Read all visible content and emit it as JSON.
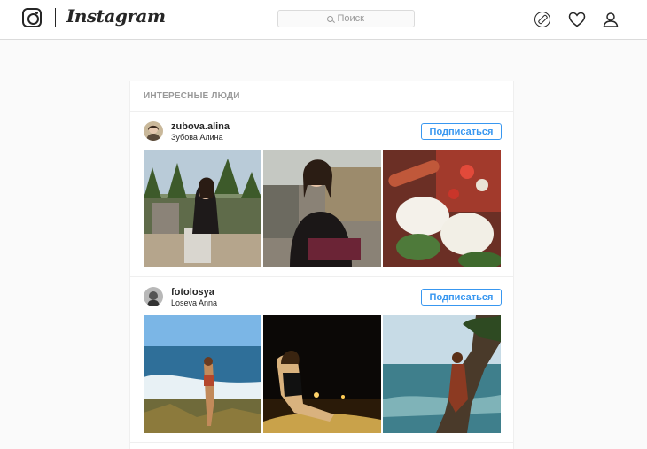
{
  "header": {
    "brand": "Instagram",
    "search_placeholder": "Поиск"
  },
  "suggestions": {
    "title": "ИНТЕРЕСНЫЕ ЛЮДИ",
    "users": [
      {
        "username": "zubova.alina",
        "full_name": "Зубова Алина",
        "follow_label": "Подписаться"
      },
      {
        "username": "fotolosya",
        "full_name": "Loseva Anna",
        "follow_label": "Подписаться"
      }
    ]
  },
  "colors": {
    "accent": "#3897f0",
    "border": "#dbdbdb",
    "muted": "#999999"
  }
}
